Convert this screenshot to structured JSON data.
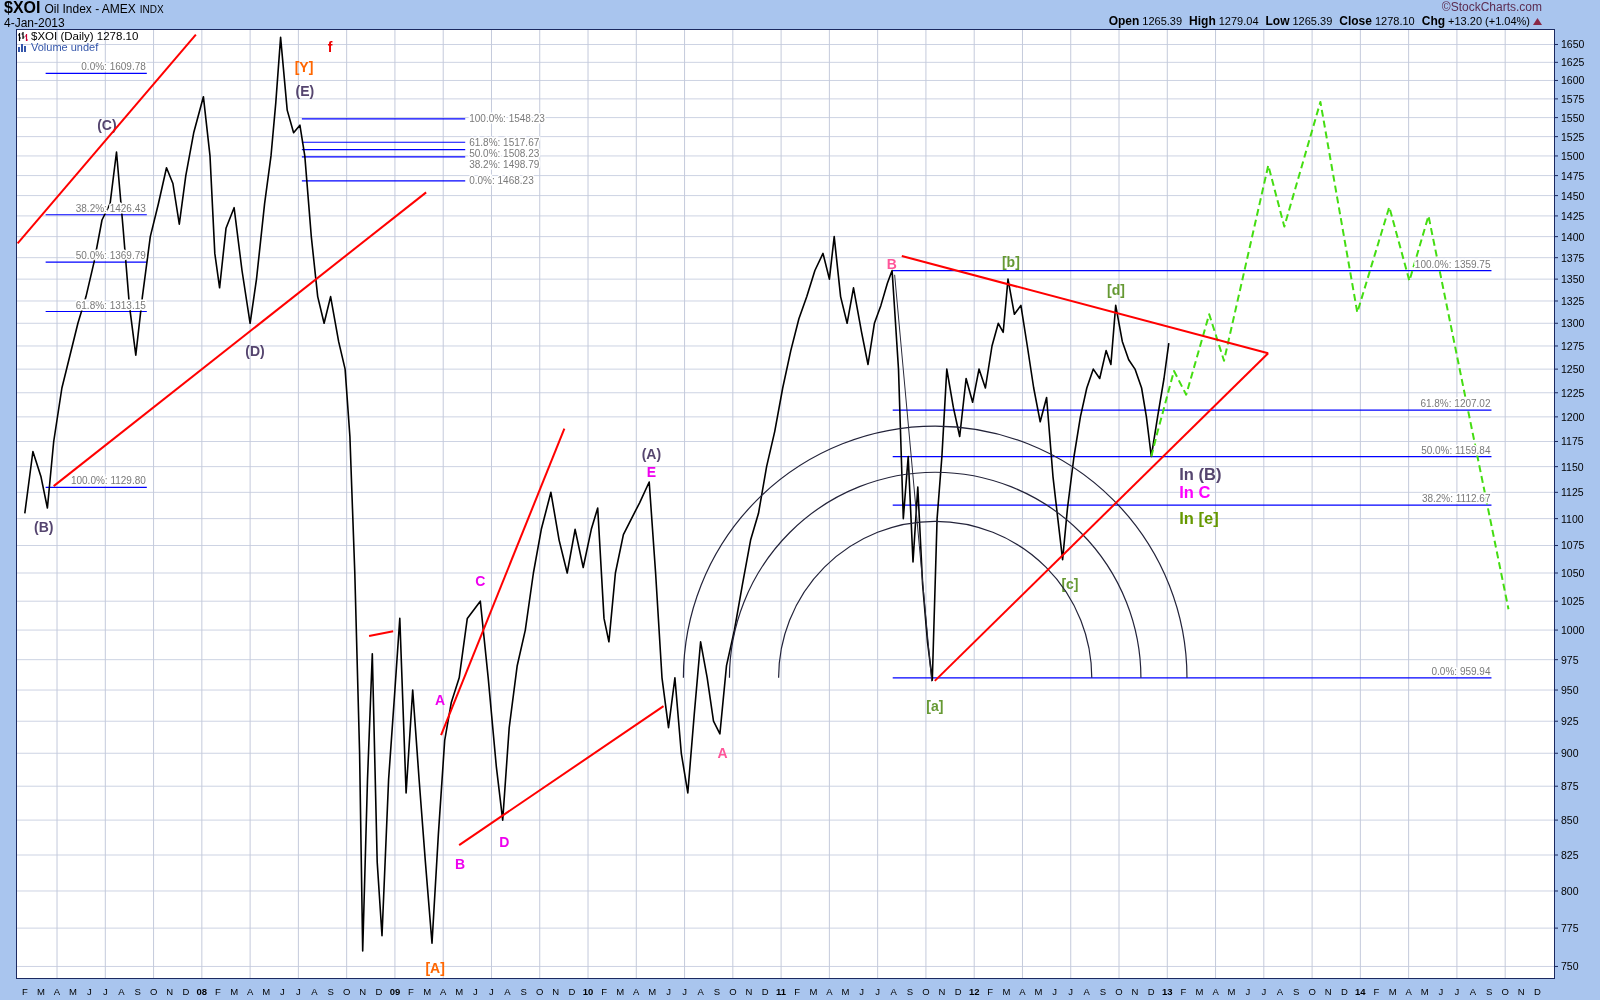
{
  "header": {
    "symbol": "$XOI",
    "name": "Oil Index - AMEX",
    "exchange": "INDX",
    "date": "4-Jan-2013",
    "credit": "©StockCharts.com",
    "quote": [
      {
        "label": "Open",
        "value": "1265.39"
      },
      {
        "label": "High",
        "value": "1279.04"
      },
      {
        "label": "Low",
        "value": "1265.39"
      },
      {
        "label": "Close",
        "value": "1278.10"
      },
      {
        "label": "Chg",
        "value": "+13.20 (+1.04%)"
      }
    ],
    "rising": true
  },
  "legend": [
    {
      "kind": "price",
      "text": "$XOI (Daily) 1278.10"
    },
    {
      "kind": "volume",
      "text": "Volume undef"
    }
  ],
  "wave_labels": [
    {
      "text": "(C)",
      "color": "#55456f"
    },
    {
      "text": "(B)",
      "color": "#55456f"
    },
    {
      "text": "[Y]",
      "color": "#ff6600"
    },
    {
      "text": "f",
      "color": "#ee0000"
    },
    {
      "text": "(E)",
      "color": "#55456f"
    },
    {
      "text": "(D)",
      "color": "#55456f"
    },
    {
      "text": "[A]",
      "color": "#ff6600"
    },
    {
      "text": "A",
      "color": "#ee00ee"
    },
    {
      "text": "B",
      "color": "#ee00ee"
    },
    {
      "text": "C",
      "color": "#ee00ee"
    },
    {
      "text": "D",
      "color": "#ee00ee"
    },
    {
      "text": "(A)",
      "color": "#55456f"
    },
    {
      "text": "E",
      "color": "#ee00ee"
    },
    {
      "text": "A",
      "color": "#ff5599"
    },
    {
      "text": "B",
      "color": "#ff5599"
    },
    {
      "text": "[a]",
      "color": "#669933"
    },
    {
      "text": "[b]",
      "color": "#669933"
    },
    {
      "text": "[c]",
      "color": "#669933"
    },
    {
      "text": "[d]",
      "color": "#669933"
    }
  ],
  "notes": [
    {
      "text": "In (B)",
      "color": "#55456f"
    },
    {
      "text": "In C",
      "color": "#ff00ff"
    },
    {
      "text": "In [e]",
      "color": "#669900"
    }
  ],
  "chart_data": {
    "type": "line",
    "log": true,
    "grid": true,
    "xlim": [
      7.0375,
      15.008
    ],
    "ylim": [
      742,
      1672
    ],
    "xticks": [
      {
        "value": 7.083,
        "label": "F"
      },
      {
        "value": 7.167,
        "label": "M"
      },
      {
        "value": 7.25,
        "label": "A"
      },
      {
        "value": 7.333,
        "label": "M"
      },
      {
        "value": 7.417,
        "label": "J"
      },
      {
        "value": 7.5,
        "label": "J"
      },
      {
        "value": 7.583,
        "label": "A"
      },
      {
        "value": 7.667,
        "label": "S"
      },
      {
        "value": 7.75,
        "label": "O"
      },
      {
        "value": 7.833,
        "label": "N"
      },
      {
        "value": 7.917,
        "label": "D"
      },
      {
        "value": 8,
        "label": "08"
      },
      {
        "value": 8.083,
        "label": "F"
      },
      {
        "value": 8.167,
        "label": "M"
      },
      {
        "value": 8.25,
        "label": "A"
      },
      {
        "value": 8.333,
        "label": "M"
      },
      {
        "value": 8.417,
        "label": "J"
      },
      {
        "value": 8.5,
        "label": "J"
      },
      {
        "value": 8.583,
        "label": "A"
      },
      {
        "value": 8.667,
        "label": "S"
      },
      {
        "value": 8.75,
        "label": "O"
      },
      {
        "value": 8.833,
        "label": "N"
      },
      {
        "value": 8.917,
        "label": "D"
      },
      {
        "value": 9,
        "label": "09"
      },
      {
        "value": 9.083,
        "label": "F"
      },
      {
        "value": 9.167,
        "label": "M"
      },
      {
        "value": 9.25,
        "label": "A"
      },
      {
        "value": 9.333,
        "label": "M"
      },
      {
        "value": 9.417,
        "label": "J"
      },
      {
        "value": 9.5,
        "label": "J"
      },
      {
        "value": 9.583,
        "label": "A"
      },
      {
        "value": 9.667,
        "label": "S"
      },
      {
        "value": 9.75,
        "label": "O"
      },
      {
        "value": 9.833,
        "label": "N"
      },
      {
        "value": 9.917,
        "label": "D"
      },
      {
        "value": 10,
        "label": "10"
      },
      {
        "value": 10.083,
        "label": "F"
      },
      {
        "value": 10.167,
        "label": "M"
      },
      {
        "value": 10.25,
        "label": "A"
      },
      {
        "value": 10.333,
        "label": "M"
      },
      {
        "value": 10.417,
        "label": "J"
      },
      {
        "value": 10.5,
        "label": "J"
      },
      {
        "value": 10.583,
        "label": "A"
      },
      {
        "value": 10.667,
        "label": "S"
      },
      {
        "value": 10.75,
        "label": "O"
      },
      {
        "value": 10.833,
        "label": "N"
      },
      {
        "value": 10.917,
        "label": "D"
      },
      {
        "value": 11,
        "label": "11"
      },
      {
        "value": 11.083,
        "label": "F"
      },
      {
        "value": 11.167,
        "label": "M"
      },
      {
        "value": 11.25,
        "label": "A"
      },
      {
        "value": 11.333,
        "label": "M"
      },
      {
        "value": 11.417,
        "label": "J"
      },
      {
        "value": 11.5,
        "label": "J"
      },
      {
        "value": 11.583,
        "label": "A"
      },
      {
        "value": 11.667,
        "label": "S"
      },
      {
        "value": 11.75,
        "label": "O"
      },
      {
        "value": 11.833,
        "label": "N"
      },
      {
        "value": 11.917,
        "label": "D"
      },
      {
        "value": 12,
        "label": "12"
      },
      {
        "value": 12.083,
        "label": "F"
      },
      {
        "value": 12.167,
        "label": "M"
      },
      {
        "value": 12.25,
        "label": "A"
      },
      {
        "value": 12.333,
        "label": "M"
      },
      {
        "value": 12.417,
        "label": "J"
      },
      {
        "value": 12.5,
        "label": "J"
      },
      {
        "value": 12.583,
        "label": "A"
      },
      {
        "value": 12.667,
        "label": "S"
      },
      {
        "value": 12.75,
        "label": "O"
      },
      {
        "value": 12.833,
        "label": "N"
      },
      {
        "value": 12.917,
        "label": "D"
      },
      {
        "value": 13,
        "label": "13"
      },
      {
        "value": 13.083,
        "label": "F"
      },
      {
        "value": 13.167,
        "label": "M"
      },
      {
        "value": 13.25,
        "label": "A"
      },
      {
        "value": 13.333,
        "label": "M"
      },
      {
        "value": 13.417,
        "label": "J"
      },
      {
        "value": 13.5,
        "label": "J"
      },
      {
        "value": 13.583,
        "label": "A"
      },
      {
        "value": 13.667,
        "label": "S"
      },
      {
        "value": 13.75,
        "label": "O"
      },
      {
        "value": 13.833,
        "label": "N"
      },
      {
        "value": 13.917,
        "label": "D"
      },
      {
        "value": 14,
        "label": "14"
      },
      {
        "value": 14.083,
        "label": "F"
      },
      {
        "value": 14.167,
        "label": "M"
      },
      {
        "value": 14.25,
        "label": "A"
      },
      {
        "value": 14.333,
        "label": "M"
      },
      {
        "value": 14.417,
        "label": "J"
      },
      {
        "value": 14.5,
        "label": "J"
      },
      {
        "value": 14.583,
        "label": "A"
      },
      {
        "value": 14.667,
        "label": "S"
      },
      {
        "value": 14.75,
        "label": "O"
      },
      {
        "value": 14.833,
        "label": "N"
      },
      {
        "value": 14.917,
        "label": "D"
      }
    ],
    "yticks": [
      750,
      775,
      800,
      825,
      850,
      875,
      900,
      925,
      950,
      975,
      1000,
      1025,
      1050,
      1075,
      1100,
      1125,
      1150,
      1175,
      1200,
      1225,
      1250,
      1275,
      1300,
      1325,
      1350,
      1375,
      1400,
      1425,
      1450,
      1475,
      1500,
      1525,
      1550,
      1575,
      1600,
      1625,
      1650
    ],
    "x": [
      7.083,
      7.125,
      7.167,
      7.2,
      7.233,
      7.275,
      7.317,
      7.358,
      7.4,
      7.442,
      7.483,
      7.525,
      7.558,
      7.592,
      7.625,
      7.658,
      7.692,
      7.733,
      7.775,
      7.817,
      7.85,
      7.883,
      7.917,
      7.958,
      8.008,
      8.042,
      8.067,
      8.092,
      8.125,
      8.167,
      8.208,
      8.25,
      8.283,
      8.325,
      8.358,
      8.383,
      8.408,
      8.442,
      8.475,
      8.508,
      8.533,
      8.567,
      8.6,
      8.633,
      8.667,
      8.708,
      8.742,
      8.767,
      8.792,
      8.817,
      8.833,
      8.858,
      8.883,
      8.908,
      8.933,
      8.967,
      9.0,
      9.025,
      9.058,
      9.092,
      9.125,
      9.158,
      9.192,
      9.225,
      9.258,
      9.292,
      9.333,
      9.375,
      9.442,
      9.483,
      9.525,
      9.558,
      9.592,
      9.633,
      9.675,
      9.717,
      9.758,
      9.808,
      9.85,
      9.892,
      9.933,
      9.975,
      10.017,
      10.05,
      10.083,
      10.108,
      10.142,
      10.183,
      10.225,
      10.267,
      10.317,
      10.35,
      10.383,
      10.417,
      10.45,
      10.483,
      10.517,
      10.55,
      10.583,
      10.617,
      10.65,
      10.683,
      10.717,
      10.758,
      10.8,
      10.842,
      10.883,
      10.925,
      10.967,
      11.008,
      11.05,
      11.092,
      11.133,
      11.175,
      11.217,
      11.25,
      11.275,
      11.308,
      11.342,
      11.375,
      11.417,
      11.45,
      11.483,
      11.517,
      11.55,
      11.575,
      11.608,
      11.633,
      11.658,
      11.683,
      11.708,
      11.733,
      11.758,
      11.783,
      11.808,
      11.833,
      11.858,
      11.892,
      11.925,
      11.958,
      11.992,
      12.025,
      12.058,
      12.092,
      12.125,
      12.15,
      12.175,
      12.208,
      12.242,
      12.275,
      12.308,
      12.342,
      12.375,
      12.408,
      12.433,
      12.458,
      12.483,
      12.517,
      12.55,
      12.583,
      12.617,
      12.65,
      12.683,
      12.708,
      12.733,
      12.767,
      12.8,
      12.833,
      12.867,
      12.892,
      12.917,
      12.95,
      12.983,
      13.008,
      13.035,
      13.098,
      13.217,
      13.294,
      13.523,
      13.606,
      13.793,
      13.984,
      14.15,
      14.254,
      14.353,
      14.767
    ],
    "series": [
      {
        "color": "#000000",
        "line_style": "solid",
        "values": [
          1105,
          1165,
          1140,
          1110,
          1175,
          1230,
          1265,
          1300,
          1330,
          1370,
          1420,
          1440,
          1505,
          1410,
          1320,
          1265,
          1330,
          1400,
          1440,
          1485,
          1465,
          1415,
          1475,
          1530,
          1578,
          1500,
          1380,
          1340,
          1410,
          1435,
          1360,
          1300,
          1350,
          1440,
          1500,
          1570,
          1660,
          1560,
          1530,
          1540,
          1500,
          1400,
          1330,
          1300,
          1330,
          1280,
          1250,
          1180,
          1050,
          900,
          760,
          880,
          980,
          820,
          770,
          880,
          950,
          1010,
          870,
          950,
          880,
          820,
          765,
          840,
          910,
          940,
          960,
          1010,
          1025,
          960,
          890,
          850,
          920,
          970,
          1000,
          1050,
          1090,
          1125,
          1080,
          1050,
          1090,
          1055,
          1090,
          1110,
          1010,
          990,
          1050,
          1085,
          1100,
          1115,
          1135,
          1050,
          960,
          920,
          960,
          900,
          870,
          930,
          990,
          960,
          925,
          915,
          970,
          1000,
          1040,
          1080,
          1105,
          1150,
          1185,
          1230,
          1270,
          1305,
          1330,
          1360,
          1380,
          1350,
          1400,
          1330,
          1300,
          1340,
          1290,
          1255,
          1300,
          1320,
          1345,
          1360,
          1250,
          1100,
          1160,
          1060,
          1130,
          1040,
          990,
          958,
          1100,
          1160,
          1250,
          1210,
          1180,
          1240,
          1215,
          1250,
          1230,
          1275,
          1300,
          1290,
          1350,
          1310,
          1320,
          1275,
          1230,
          1195,
          1220,
          1140,
          1100,
          1062,
          1110,
          1160,
          1200,
          1230,
          1250,
          1240,
          1270,
          1255,
          1320,
          1280,
          1260,
          1250,
          1230,
          1200,
          1160,
          1200,
          1240,
          1278,
          null,
          null,
          null,
          null,
          null,
          null,
          null,
          null,
          null,
          null,
          null,
          null
        ]
      },
      {
        "color": "#44dd11",
        "line_style": "dashed",
        "values": [
          null,
          null,
          null,
          null,
          null,
          null,
          null,
          null,
          null,
          null,
          null,
          null,
          null,
          null,
          null,
          null,
          null,
          null,
          null,
          null,
          null,
          null,
          null,
          null,
          null,
          null,
          null,
          null,
          null,
          null,
          null,
          null,
          null,
          null,
          null,
          null,
          null,
          null,
          null,
          null,
          null,
          null,
          null,
          null,
          null,
          null,
          null,
          null,
          null,
          null,
          null,
          null,
          null,
          null,
          null,
          null,
          null,
          null,
          null,
          null,
          null,
          null,
          null,
          null,
          null,
          null,
          null,
          null,
          null,
          null,
          null,
          null,
          null,
          null,
          null,
          null,
          null,
          null,
          null,
          null,
          null,
          null,
          null,
          null,
          null,
          null,
          null,
          null,
          null,
          null,
          null,
          null,
          null,
          null,
          null,
          null,
          null,
          null,
          null,
          null,
          null,
          null,
          null,
          null,
          null,
          null,
          null,
          null,
          null,
          null,
          null,
          null,
          null,
          null,
          null,
          null,
          null,
          null,
          null,
          null,
          null,
          null,
          null,
          null,
          null,
          null,
          null,
          null,
          null,
          null,
          null,
          null,
          null,
          null,
          null,
          null,
          null,
          null,
          null,
          null,
          null,
          null,
          null,
          null,
          null,
          null,
          null,
          null,
          null,
          null,
          null,
          null,
          null,
          null,
          null,
          null,
          null,
          null,
          null,
          null,
          null,
          null,
          null,
          null,
          null,
          null,
          null,
          null,
          null,
          null,
          1160,
          1185,
          1209,
          1228,
          1248,
          1223,
          1310,
          1259,
          1488,
          1412,
          1571,
          1312,
          1436,
          1348,
          1425,
          1018
        ]
      }
    ],
    "ref_lines": [
      {
        "axis": "y",
        "value": 1609.78,
        "label": "0.0%: 1609.78"
      },
      {
        "axis": "y",
        "value": 1426.43,
        "label": "38.2%: 1426.43"
      },
      {
        "axis": "y",
        "value": 1369.79,
        "label": "50.0%: 1369.79"
      },
      {
        "axis": "y",
        "value": 1313.15,
        "label": "61.8%: 1313.15"
      },
      {
        "axis": "y",
        "value": 1129.8,
        "label": "100.0%: 1129.80"
      },
      {
        "axis": "y",
        "value": 1548.23,
        "label": "100.0%: 1548.23"
      },
      {
        "axis": "y",
        "value": 1517.67,
        "label": "61.8%: 1517.67"
      },
      {
        "axis": "y",
        "value": 1508.23,
        "label": "50.0%: 1508.23"
      },
      {
        "axis": "y",
        "value": 1498.79,
        "label": "38.2%: 1498.79"
      },
      {
        "axis": "y",
        "value": 1468.23,
        "label": "0.0%: 1468.23"
      },
      {
        "axis": "y",
        "value": 1359.75,
        "label": "100.0%: 1359.75"
      },
      {
        "axis": "y",
        "value": 1207.02,
        "label": "61.8%: 1207.02"
      },
      {
        "axis": "y",
        "value": 1159.84,
        "label": "50.0%: 1159.84"
      },
      {
        "axis": "y",
        "value": 1112.67,
        "label": "38.2%: 1112.67"
      },
      {
        "axis": "y",
        "value": 959.94,
        "label": "0.0%: 959.94"
      }
    ]
  }
}
